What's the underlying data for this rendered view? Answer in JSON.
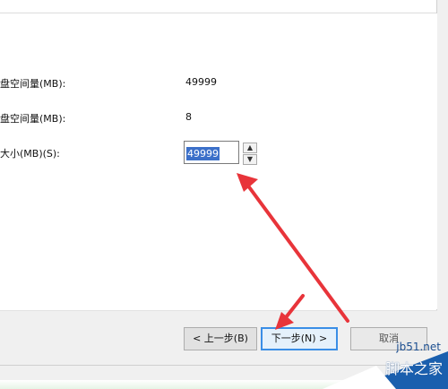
{
  "fields": {
    "max_space_label": "盘空间量(MB):",
    "max_space_value": "49999",
    "min_space_label": "盘空间量(MB):",
    "min_space_value": "8",
    "size_label": "大小(MB)(S):",
    "size_value": "49999"
  },
  "buttons": {
    "back": "< 上一步(B)",
    "next": "下一步(N) >",
    "cancel": "取消"
  },
  "watermark": {
    "site": "jb51.net",
    "name": "脚本之家"
  },
  "colors": {
    "arrow": "#e8343a",
    "selection": "#3c70c9",
    "primary_border": "#3a8ee6"
  }
}
